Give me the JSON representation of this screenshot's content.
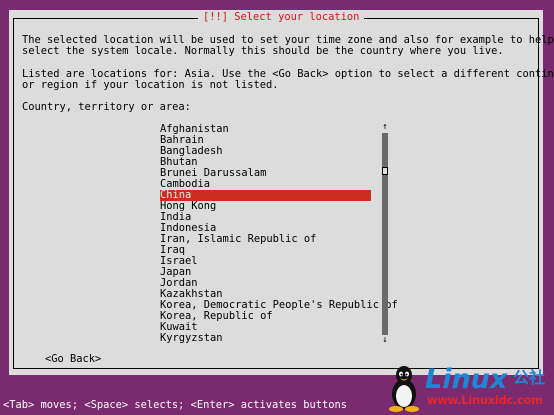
{
  "dialog": {
    "title": "[!!] Select your location",
    "description": "The selected location will be used to set your time zone and also for example to help\nselect the system locale. Normally this should be the country where you live.",
    "locations_note": "Listed are locations for: Asia. Use the <Go Back> option to select a different continent\nor region if your location is not listed.",
    "prompt": "Country, territory or area:",
    "countries": [
      "Afghanistan",
      "Bahrain",
      "Bangladesh",
      "Bhutan",
      "Brunei Darussalam",
      "Cambodia",
      "China",
      "Hong Kong",
      "India",
      "Indonesia",
      "Iran, Islamic Republic of",
      "Iraq",
      "Israel",
      "Japan",
      "Jordan",
      "Kazakhstan",
      "Korea, Democratic People's Republic of",
      "Korea, Republic of",
      "Kuwait",
      "Kyrgyzstan"
    ],
    "selected_country": "China",
    "go_back_label": "<Go Back>",
    "scroll_up_arrow": "↑",
    "scroll_down_arrow": "↓"
  },
  "footer": {
    "help_text": "<Tab> moves; <Space> selects; <Enter> activates buttons"
  },
  "watermark": {
    "brand": "Linux",
    "brand_cn": "公社",
    "url": "www.Linuxidc.com"
  },
  "colors": {
    "background": "#7a2a6e",
    "dialog": "#dcdcdc",
    "selection": "#cc2d1e",
    "title": "#d01818",
    "logo_blue": "#1d86d6",
    "logo_red": "#e8262a"
  }
}
